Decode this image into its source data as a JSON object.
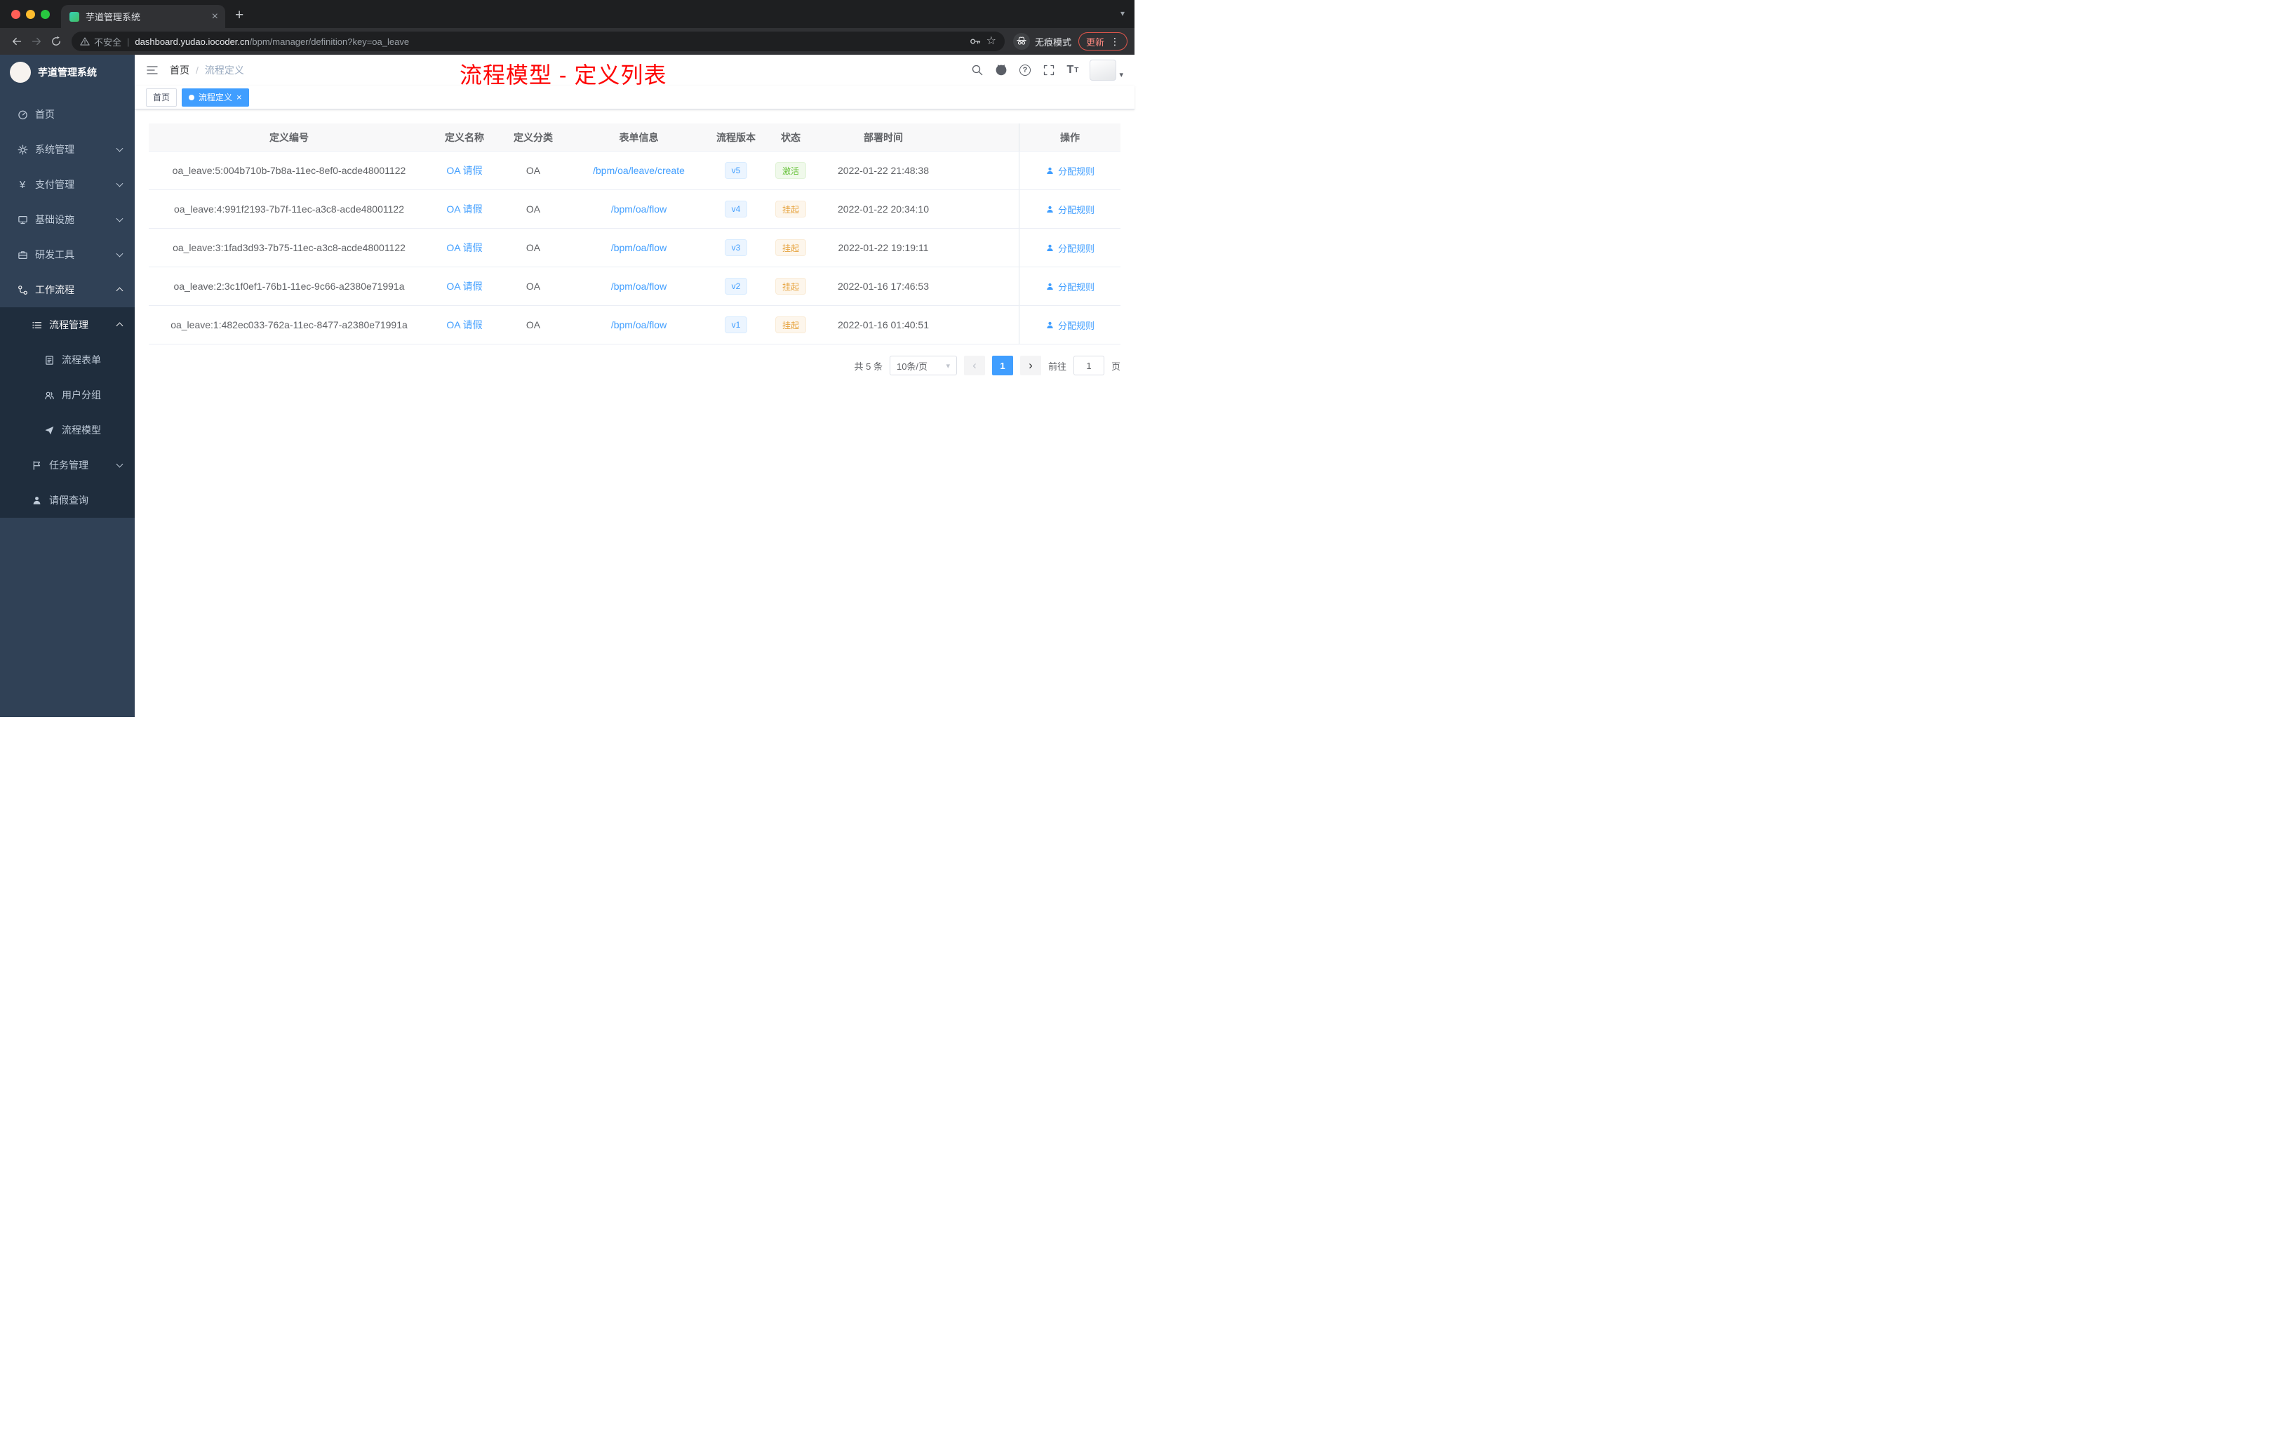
{
  "colors": {
    "accent": "#409eff",
    "success": "#67c23a",
    "warning": "#e6a23c",
    "sidebar_bg": "#304156",
    "submenu_bg": "#1f2d3d",
    "annotation_red": "#fe0505"
  },
  "icons": {
    "star": "☆",
    "menu_dots": "⋮",
    "plus": "+",
    "close": "×",
    "caret_down": "▾",
    "angle_left": "‹",
    "angle_right": "›",
    "question": "?",
    "yen": "¥",
    "divider": "|",
    "font_large": "T",
    "font_small": "T"
  },
  "browser": {
    "tab": {
      "title": "芋道管理系统"
    },
    "address": {
      "security_label": "不安全",
      "host": "dashboard.yudao.iocoder.cn",
      "path": "/bpm/manager/definition?key=oa_leave"
    },
    "incognito_label": "无痕模式",
    "update_label": "更新"
  },
  "sidebar": {
    "app_title": "芋道管理系统",
    "menu": [
      {
        "label": "首页"
      },
      {
        "label": "系统管理"
      },
      {
        "label": "支付管理"
      },
      {
        "label": "基础设施"
      },
      {
        "label": "研发工具"
      },
      {
        "label": "工作流程"
      },
      {
        "label": "流程管理"
      },
      {
        "label": "流程表单"
      },
      {
        "label": "用户分组"
      },
      {
        "label": "流程模型"
      },
      {
        "label": "任务管理"
      },
      {
        "label": "请假查询"
      }
    ]
  },
  "header": {
    "breadcrumb": {
      "items": [
        "首页",
        "流程定义"
      ],
      "separator": "/"
    },
    "annotation": "流程模型 - 定义列表"
  },
  "tags": [
    {
      "label": "首页",
      "active": false
    },
    {
      "label": "流程定义",
      "active": true
    }
  ],
  "table": {
    "columns": [
      "定义编号",
      "定义名称",
      "定义分类",
      "表单信息",
      "流程版本",
      "状态",
      "部署时间",
      "操作"
    ],
    "rows": [
      {
        "id": "oa_leave:5:004b710b-7b8a-11ec-8ef0-acde48001122",
        "name": "OA 请假",
        "category": "OA",
        "form": "/bpm/oa/leave/create",
        "version": "v5",
        "status": "激活",
        "status_type": "success",
        "deploy_time": "2022-01-22 21:48:38",
        "action": "分配规则"
      },
      {
        "id": "oa_leave:4:991f2193-7b7f-11ec-a3c8-acde48001122",
        "name": "OA 请假",
        "category": "OA",
        "form": "/bpm/oa/flow",
        "version": "v4",
        "status": "挂起",
        "status_type": "warning",
        "deploy_time": "2022-01-22 20:34:10",
        "action": "分配规则"
      },
      {
        "id": "oa_leave:3:1fad3d93-7b75-11ec-a3c8-acde48001122",
        "name": "OA 请假",
        "category": "OA",
        "form": "/bpm/oa/flow",
        "version": "v3",
        "status": "挂起",
        "status_type": "warning",
        "deploy_time": "2022-01-22 19:19:11",
        "action": "分配规则"
      },
      {
        "id": "oa_leave:2:3c1f0ef1-76b1-11ec-9c66-a2380e71991a",
        "name": "OA 请假",
        "category": "OA",
        "form": "/bpm/oa/flow",
        "version": "v2",
        "status": "挂起",
        "status_type": "warning",
        "deploy_time": "2022-01-16 17:46:53",
        "action": "分配规则"
      },
      {
        "id": "oa_leave:1:482ec033-762a-11ec-8477-a2380e71991a",
        "name": "OA 请假",
        "category": "OA",
        "form": "/bpm/oa/flow",
        "version": "v1",
        "status": "挂起",
        "status_type": "warning",
        "deploy_time": "2022-01-16 01:40:51",
        "action": "分配规则"
      }
    ]
  },
  "pagination": {
    "total": "共 5 条",
    "page_size": "10条/页",
    "page": "1",
    "goto_prefix": "前往",
    "goto_value": "1",
    "goto_suffix": "页"
  }
}
